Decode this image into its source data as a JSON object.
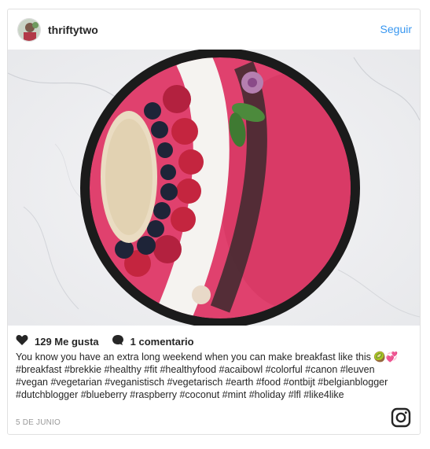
{
  "header": {
    "username": "thriftytwo",
    "follow_label": "Seguir"
  },
  "actions": {
    "likes_text": "129 Me gusta",
    "comments_text": "1 comentario"
  },
  "caption": {
    "text": "You know you have an extra long weekend when you can make breakfast like this 🥝💞 #breakfast #brekkie #healthy #fit #healthyfood #acaibowl #colorful #canon #leuven #vegan #vegetarian #veganistisch #vegetarisch #earth #food #ontbijt #belgianblogger #dutchblogger #blueberry #raspberry #coconut #mint #holiday #lfl #like4like"
  },
  "date": "5 DE JUNIO",
  "icons": {
    "like": "heart-icon",
    "comment": "comment-bubble-icon",
    "brand": "instagram-icon"
  },
  "colors": {
    "accent": "#3897f0",
    "text": "#262626",
    "muted": "#999999",
    "smoothie": "#e0416e"
  }
}
